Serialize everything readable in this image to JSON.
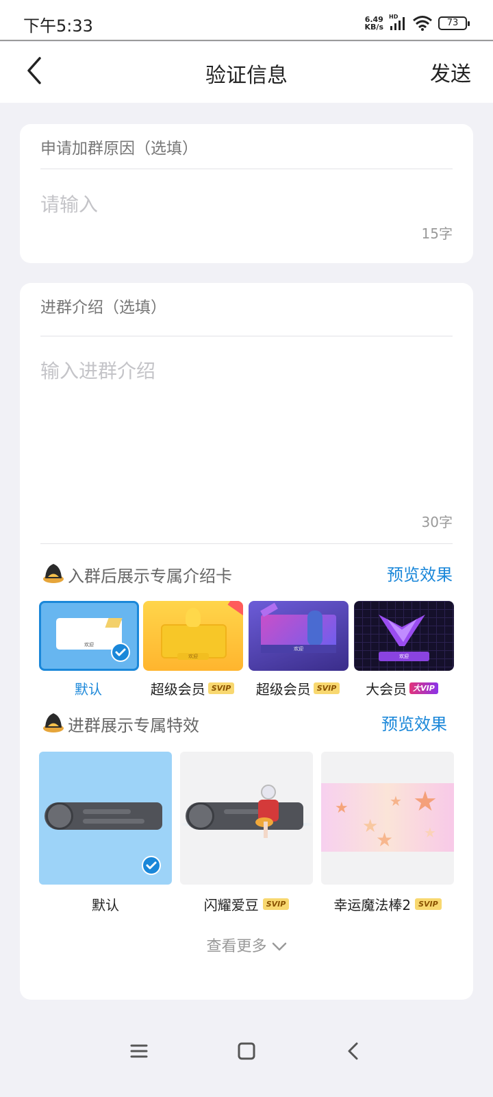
{
  "status_bar": {
    "time": "下午5:33",
    "net_speed_top": "6.49",
    "net_speed_bottom": "KB/s",
    "network": "HD",
    "battery": "73"
  },
  "nav": {
    "title": "验证信息",
    "send_label": "发送"
  },
  "reason": {
    "label": "申请加群原因（选填）",
    "placeholder": "请输入",
    "counter": "15字"
  },
  "intro": {
    "label": "进群介绍（选填）",
    "placeholder": "输入进群介绍",
    "counter": "30字"
  },
  "intro_card_section": {
    "title": "入群后展示专属介绍卡",
    "preview_label": "预览效果",
    "cards": [
      {
        "label": "默认",
        "badge": "",
        "selected": true,
        "mini_text": "欢迎"
      },
      {
        "label": "超级会员",
        "badge": "SVIP",
        "selected": false,
        "mini_text": "欢迎"
      },
      {
        "label": "超级会员",
        "badge": "SVIP",
        "selected": false,
        "mini_text": "欢迎"
      },
      {
        "label": "大会员",
        "badge": "大VIP",
        "selected": false,
        "mini_text": "欢迎"
      }
    ]
  },
  "effect_section": {
    "title": "进群展示专属特效",
    "preview_label": "预览效果",
    "effects": [
      {
        "label": "默认",
        "badge": "",
        "selected": true
      },
      {
        "label": "闪耀爱豆",
        "badge": "SVIP",
        "selected": false
      },
      {
        "label": "幸运魔法棒2",
        "badge": "SVIP",
        "selected": false
      }
    ],
    "see_more_label": "查看更多"
  },
  "colors": {
    "accent": "#1a87d9",
    "background": "#f1f1f6",
    "svip_badge": "#f8d870"
  },
  "icons": [
    "back-arrow-icon",
    "wifi-icon",
    "signal-icon",
    "battery-icon",
    "penguin-hat-icon",
    "checkmark-icon",
    "chevron-down-icon",
    "menu-icon",
    "home-square-icon",
    "back-chevron-icon"
  ]
}
